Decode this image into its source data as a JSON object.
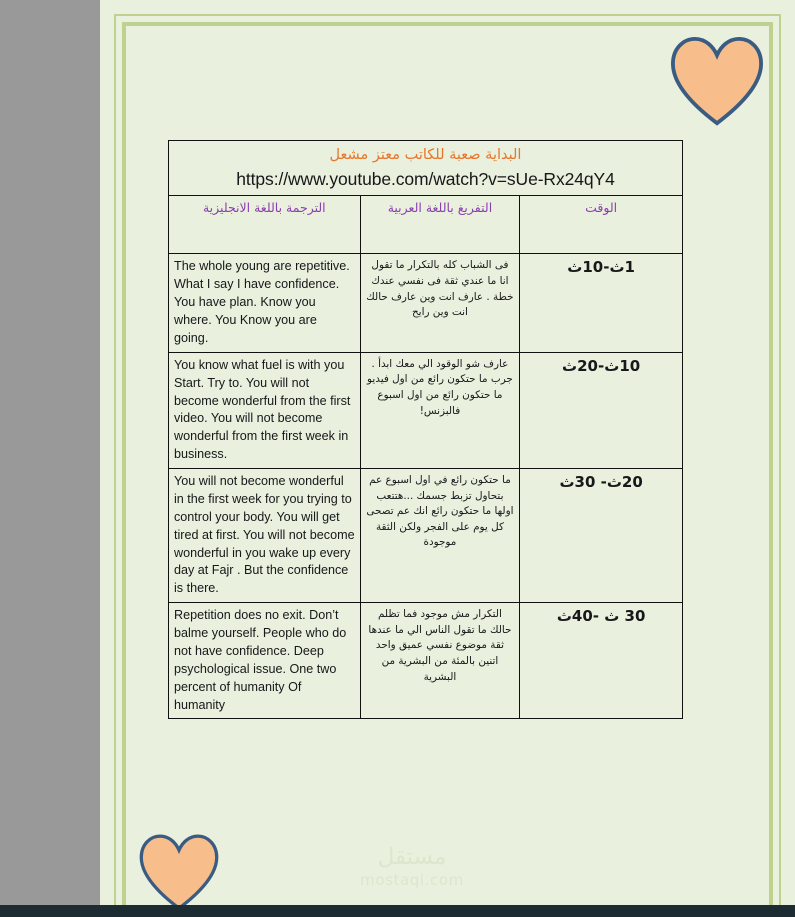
{
  "document": {
    "banner": {
      "title_ar": "البداية صعبة للكاتب معتز مشعل",
      "url": "https://www.youtube.com/watch?v=sUe-Rx24qY4",
      "title_color": "#e8762a",
      "url_color": "#16181a"
    },
    "columns": [
      {
        "label": "الترجمة باللغة الانجليزية",
        "key": "english"
      },
      {
        "label": "التفريغ باللغة العربية",
        "key": "arabic"
      },
      {
        "label": "الوقت",
        "key": "time"
      }
    ],
    "column_header_color": "#8b3fae",
    "rows": [
      {
        "english": "The  whole young are repetitive.\nWhat I say I have confidence.\nYou have plan. Know you where.\nYou Know you are going.",
        "arabic": "فى الشباب كله بالتكرار\nما تقول انا ما عندي ثقة فى نفسي\nعندك خطة . عارف انت وين\nعارف حالك انت وين رايح",
        "time": "1ث-10ث"
      },
      {
        "english": "You know what fuel is with you  Start. Try to.\nYou will not become wonderful  from  the first video.\nYou will not become wonderful from the first week in business.",
        "arabic": "عارف شو الوقود الي معك\nابدأ . جرب\nما حتكون رائع من اول فيديو\nما حتكون رائع من اول اسبوع فالبزنس!",
        "time": "10ث-20ث"
      },
      {
        "english": "You will not become wonderful in the first week for you trying to control your body.\nYou will get tired at first.\nYou will not become wonderful  in you wake up every day at Fajr .\nBut the confidence is there.",
        "arabic": "ما حتكون رائع  في اول اسبوع عم بتحاول تزبط جسمك ...هتتعب اولها\nما حتكون رائع انك عم تصحى كل يوم على الفجر\nولكن الثقة موجودة",
        "time": "20ث-  30ث"
      },
      {
        "english": "Repetition does no exit.\nDon’t balme yourself.\nPeople who do not have confidence.\nDeep psychological issue.\nOne  two percent of humanity\nOf humanity",
        "arabic": "التكرار مش موجود\nفما تظلم حالك\nما تقول\nالناس الي ما عندها ثقة\nموضوع نفسي عميق\nواحد اتنين بالمئة من البشرية\nمن البشرية",
        "time": "30 ث -40ث"
      }
    ]
  },
  "decorations": {
    "heart_fill": "#f7bd8a",
    "heart_stroke": "#3a5b82",
    "border_color": "#bed18f",
    "page_background": "#e9f0dd",
    "canvas_background": "#999999",
    "bottom_bar_color": "#1d2b33"
  },
  "watermark": {
    "arabic": "مستقل",
    "latin": "mostaql.com"
  }
}
